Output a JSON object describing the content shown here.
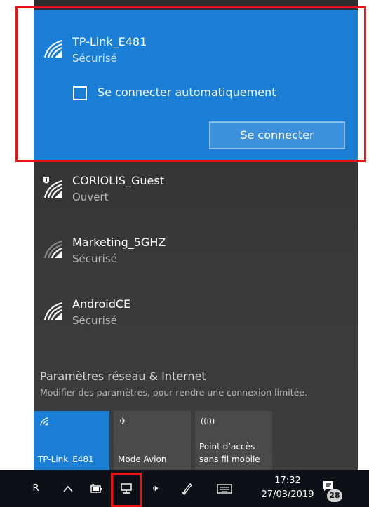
{
  "networks": [
    {
      "name": "TP-Link_E481",
      "status": "Sécurisé"
    },
    {
      "name": "CORIOLIS_Guest",
      "status": "Ouvert"
    },
    {
      "name": "Marketing_5GHZ",
      "status": "Sécurisé"
    },
    {
      "name": "AndroidCE",
      "status": "Sécurisé"
    }
  ],
  "selected": {
    "auto_connect_label": "Se connecter automatiquement",
    "connect_button": "Se connecter"
  },
  "settings": {
    "link": "Paramètres réseau & Internet",
    "description": "Modifier des paramètres, pour rendre une connexion limitée."
  },
  "quick_tiles": [
    {
      "label": "TP-Link_E481",
      "icon": "wifi-icon"
    },
    {
      "label": "Mode Avion",
      "icon": "airplane-icon"
    },
    {
      "label_line1": "Point d’accès",
      "label_line2": "sans fil mobile",
      "icon": "hotspot-icon"
    }
  ],
  "taskbar": {
    "left_char": "R",
    "time": "17:32",
    "date": "27/03/2019",
    "notification_count": "28"
  },
  "colors": {
    "accent": "#1a7fd4",
    "panel": "#2b2b2b",
    "highlight": "#ee1111"
  }
}
